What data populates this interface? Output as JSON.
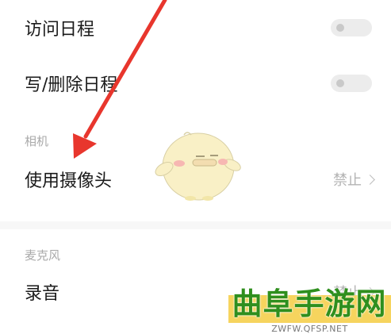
{
  "calendar": {
    "items": [
      {
        "label": "访问日程",
        "enabled": false
      },
      {
        "label": "写/删除日程",
        "enabled": false
      }
    ]
  },
  "camera": {
    "section_title": "相机",
    "items": [
      {
        "label": "使用摄像头",
        "status": "禁止"
      }
    ]
  },
  "microphone": {
    "section_title": "麦克风",
    "items": [
      {
        "label": "录音",
        "status": "禁止"
      }
    ]
  },
  "watermark": {
    "site_name": "曲阜手游网",
    "site_url": "ZWFW.QFSP.NET"
  },
  "colors": {
    "arrow": "#e8362d",
    "watermark_green": "#2f8f1e",
    "watermark_band": "#f6d45e"
  },
  "icons": {
    "chevron": "chevron-right-icon",
    "mascot": "chick-mascot"
  }
}
